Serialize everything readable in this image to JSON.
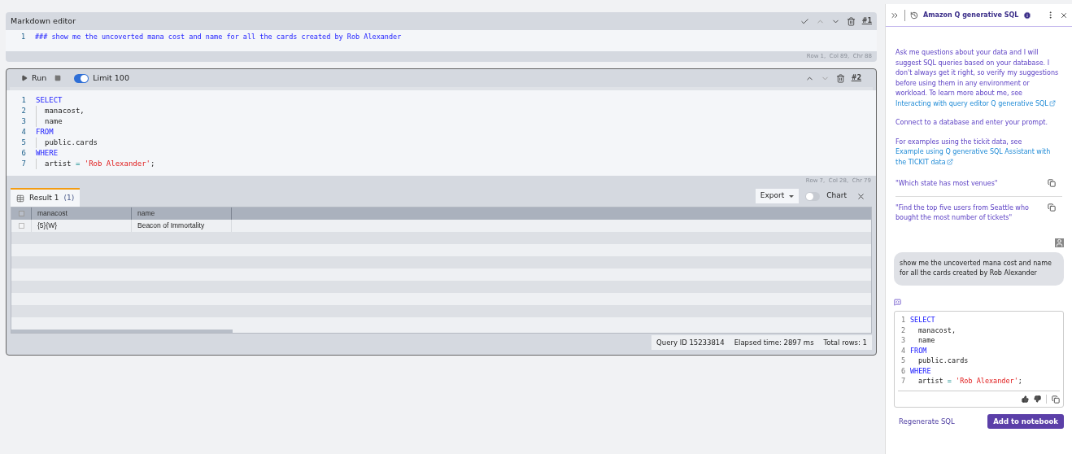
{
  "markdown_cell": {
    "title": "Markdown editor",
    "number": "#1",
    "lines": [
      {
        "number": "1",
        "text": "### show me the uncoverted mana cost and name for all the cards created by Rob Alexander"
      }
    ],
    "cursor": "Row 1,  Col 89,  Chr 88"
  },
  "sql_cell": {
    "run": "Run",
    "limit": {
      "label": "Limit 100",
      "on": true
    },
    "number": "#2",
    "lines": [
      {
        "number": "1",
        "indent": false,
        "tokens": [
          {
            "kind": "keyword",
            "text": "SELECT"
          }
        ]
      },
      {
        "number": "2",
        "indent": true,
        "tokens": [
          {
            "kind": "plain",
            "text": "manacost,"
          }
        ]
      },
      {
        "number": "3",
        "indent": true,
        "tokens": [
          {
            "kind": "plain",
            "text": "name"
          }
        ]
      },
      {
        "number": "4",
        "indent": false,
        "tokens": [
          {
            "kind": "keyword",
            "text": "FROM"
          }
        ]
      },
      {
        "number": "5",
        "indent": true,
        "tokens": [
          {
            "kind": "plain",
            "text": "public.cards"
          }
        ]
      },
      {
        "number": "6",
        "indent": false,
        "tokens": [
          {
            "kind": "keyword",
            "text": "WHERE"
          }
        ]
      },
      {
        "number": "7",
        "indent": true,
        "tokens": [
          {
            "kind": "plain",
            "text": "artist"
          },
          {
            "kind": "operator",
            "text": "="
          },
          {
            "kind": "string",
            "text": "'Rob Alexander'"
          },
          {
            "kind": "punctuation",
            "text": ";"
          }
        ]
      }
    ],
    "cursor": "Row 7,  Col 28,  Chr 79"
  },
  "results": {
    "tabs": [
      {
        "label": "Result 1",
        "count": "(1)",
        "selected": true
      }
    ],
    "export": "Export",
    "chart": {
      "label": "Chart",
      "on": false
    },
    "header_checked": false,
    "columns": [
      "manacost",
      "name"
    ],
    "rows": [
      {
        "checked": false,
        "cells": [
          "{5}{W}",
          "Beacon of Immortality"
        ]
      }
    ],
    "status": [
      "Query ID 15233814",
      "Elapsed time: 2897 ms",
      "Total rows: 1"
    ]
  },
  "assistant": {
    "title": "Amazon Q generative SQL",
    "intro": [
      {
        "text": "Ask me questions about your data and I will suggest SQL queries based on your database. I don't always get it right, so verify my suggestions before using them in any environment or workload. To learn more about me, see ",
        "link": "Interacting with query editor Q generative SQL"
      },
      {
        "text": "Connect to a database and enter your prompt."
      },
      {
        "text": "For examples using the tickit data, see ",
        "link": "Example using Q generative SQL Assistant with the TICKIT data"
      }
    ],
    "examples": [
      "\"Which state has most venues\"",
      "\"Find the top five users from Seattle who bought the most number of tickets\""
    ],
    "prompt": "show me the uncoverted mana cost and name for all the cards created by Rob Alexander",
    "answer_lines": [
      {
        "number": "1",
        "indent": false,
        "tokens": [
          {
            "kind": "keyword",
            "text": "SELECT"
          }
        ]
      },
      {
        "number": "2",
        "indent": true,
        "tokens": [
          {
            "kind": "plain",
            "text": "manacost,"
          }
        ]
      },
      {
        "number": "3",
        "indent": true,
        "tokens": [
          {
            "kind": "plain",
            "text": "name"
          }
        ]
      },
      {
        "number": "4",
        "indent": false,
        "tokens": [
          {
            "kind": "keyword",
            "text": "FROM"
          }
        ]
      },
      {
        "number": "5",
        "indent": true,
        "tokens": [
          {
            "kind": "plain",
            "text": "public.cards"
          }
        ]
      },
      {
        "number": "6",
        "indent": false,
        "tokens": [
          {
            "kind": "keyword",
            "text": "WHERE"
          }
        ]
      },
      {
        "number": "7",
        "indent": true,
        "tokens": [
          {
            "kind": "plain",
            "text": "artist"
          },
          {
            "kind": "operator",
            "text": "="
          },
          {
            "kind": "string",
            "text": "'Rob Alexander'"
          },
          {
            "kind": "punctuation",
            "text": ";"
          }
        ]
      }
    ],
    "regenerate": "Regenerate SQL",
    "add": "Add to notebook"
  }
}
